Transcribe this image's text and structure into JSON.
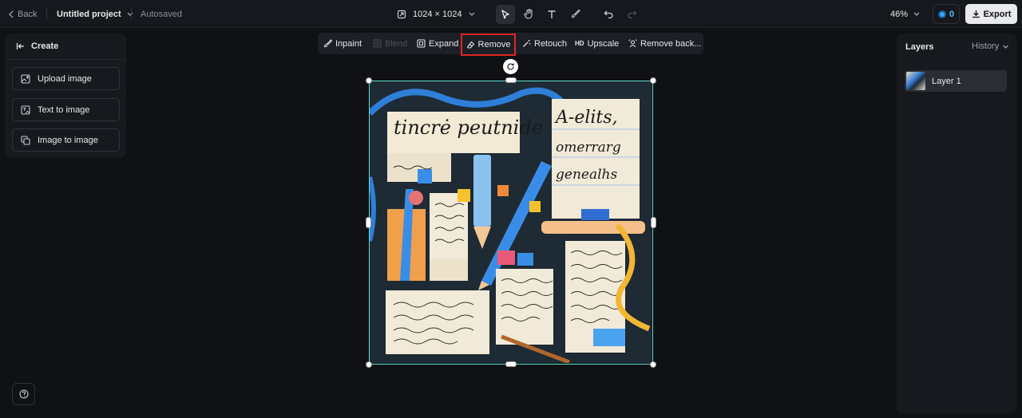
{
  "topbar": {
    "back_label": "Back",
    "project_name": "Untitled project",
    "save_status": "Autosaved",
    "canvas_size": "1024 × 1024",
    "zoom_level": "46%",
    "credits": "0",
    "export_label": "Export"
  },
  "left_panel": {
    "title": "Create",
    "buttons": [
      {
        "label": "Upload image",
        "icon": "upload-image-icon"
      },
      {
        "label": "Text to image",
        "icon": "text-to-image-icon"
      },
      {
        "label": "Image to image",
        "icon": "image-to-image-icon"
      }
    ]
  },
  "edit_toolbar": {
    "items": [
      {
        "label": "Inpaint",
        "icon": "brush-icon",
        "enabled": true
      },
      {
        "label": "Blend",
        "icon": "blend-icon",
        "enabled": false
      },
      {
        "label": "Expand",
        "icon": "expand-icon",
        "enabled": true
      },
      {
        "label": "Remove",
        "icon": "eraser-icon",
        "enabled": true,
        "highlighted": true
      },
      {
        "label": "Retouch",
        "icon": "magic-wand-icon",
        "enabled": true
      },
      {
        "label": "Upscale",
        "icon": "hd-icon",
        "enabled": true
      },
      {
        "label": "Remove back...",
        "icon": "remove-background-icon",
        "enabled": true
      }
    ],
    "highlight_color": "#e02424"
  },
  "canvas": {
    "image_text": {
      "card1": "tincrė peutnide",
      "card2": "A-elits,",
      "card3": "omerrarg",
      "card4": "genealhs"
    },
    "selection_color": "#5fe0d0"
  },
  "right_panel": {
    "title": "Layers",
    "history_label": "History",
    "layers": [
      {
        "name": "Layer 1"
      }
    ]
  }
}
